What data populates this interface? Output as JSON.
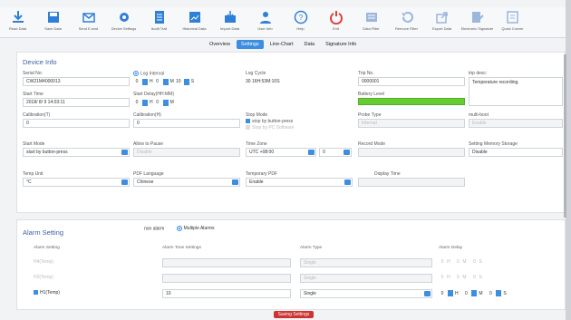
{
  "toolbar": [
    {
      "label": "Read Data",
      "icon": "download-icon",
      "color": "#2f7fd6"
    },
    {
      "label": "Save Data",
      "icon": "save-icon",
      "color": "#2f7fd6"
    },
    {
      "label": "Send E-mail",
      "icon": "mail-icon",
      "color": "#2f7fd6"
    },
    {
      "label": "Device Settings",
      "icon": "gear-icon",
      "color": "#2f7fd6"
    },
    {
      "label": "Audit Trail",
      "icon": "document-icon",
      "color": "#2f7fd6"
    },
    {
      "label": "Historical Data",
      "icon": "history-icon",
      "color": "#2f7fd6"
    },
    {
      "label": "Import Data",
      "icon": "import-icon",
      "color": "#2f7fd6"
    },
    {
      "label": "User Info",
      "icon": "user-icon",
      "color": "#2f7fd6"
    },
    {
      "label": "Help",
      "icon": "help-icon",
      "color": "#2f7fd6"
    },
    {
      "label": "Exit",
      "icon": "power-icon",
      "color": "#e04040"
    },
    {
      "label": "Data Filter",
      "icon": "filter-icon",
      "color": "#9cb6dc"
    },
    {
      "label": "Remove Filter",
      "icon": "undo-icon",
      "color": "#9cb6dc"
    },
    {
      "label": "Export Data",
      "icon": "export-icon",
      "color": "#9cb6dc"
    },
    {
      "label": "Electronic Signature",
      "icon": "signature-icon",
      "color": "#9cb6dc"
    },
    {
      "label": "Quick Conver",
      "icon": "convert-icon",
      "color": "#9cb6dc"
    }
  ],
  "tabs": [
    "Overview",
    "Settings",
    "Line-Chart",
    "Data",
    "Signature Info"
  ],
  "active_tab": 1,
  "device": {
    "title": "Device Info",
    "serial_no_label": "Serial No:",
    "serial_no": "CW21M4000013",
    "log_interval_label": "Log Interval",
    "log_interval": {
      "h": "0",
      "h_unit": "H",
      "m": "0",
      "m_unit": "M",
      "s": "10",
      "s_unit": "S"
    },
    "log_cycle_label": "Log Cycle",
    "log_cycle": "30 16H:53M:10S",
    "trip_no_label": "Trip No.",
    "trip_no": "0000001",
    "trip_desc_label": "trip desc:",
    "trip_desc": "Temperature recording.",
    "start_time_label": "Start Time",
    "start_time": "2018/ 8/ 9 14:03:11",
    "start_delay_label": "Start Delay(HH:MM)",
    "start_delay": {
      "h": "0",
      "h_unit": "H",
      "m": "0",
      "m_unit": "M"
    },
    "battery_label": "Battery Level",
    "calib_t_label": "Calibration(T)",
    "calib_t": "0",
    "calib_h_label": "Calibration(H)",
    "calib_h": "0",
    "stop_mode_label": "Stop Mode",
    "stop_opt1": "stop by button-press",
    "stop_opt2": "Stop by PC Software",
    "probe_type_label": "Probe Type",
    "probe_type": "Internal",
    "multi_boot_label": "multi-boot",
    "multi_boot": "Enable",
    "start_mode_label": "Start Mode",
    "start_mode": "start by button-press",
    "allow_pause_label": "Allow to Pause",
    "allow_pause": "Disable",
    "time_zone_label": "Time Zone",
    "time_zone": "UTC +08:00",
    "time_zone_min": "0",
    "record_mode_label": "Record Mode",
    "setting_memory_label": "Setting Memory Storage",
    "setting_memory": "Disable",
    "temp_unit_label": "Temp Unit",
    "temp_unit": "°C",
    "pdf_lang_label": "PDF Language",
    "pdf_lang": "Chinese",
    "temp_pdf_label": "Temporary PDF",
    "temp_pdf": "Enable",
    "display_time_label": "Display Time"
  },
  "alarm": {
    "title": "Alarm Setting",
    "mode_none": "non alarm",
    "mode_multi": "Multiple Alarms",
    "col_setting": "Alarm Setting",
    "col_tone": "Alarm Tone Settings",
    "col_type": "Alarm Type",
    "col_delay": "Alarm Delay",
    "rows": [
      {
        "label": "H4(Temp)",
        "checked": false,
        "tone": "",
        "type": "Single",
        "h": "0",
        "m": "0",
        "s": "0",
        "enabled": false
      },
      {
        "label": "H2(Temp)",
        "checked": false,
        "tone": "",
        "type": "Single",
        "h": "0",
        "m": "0",
        "s": "0",
        "enabled": false
      },
      {
        "label": "H1(Temp)",
        "checked": true,
        "tone": "10",
        "type": "Single",
        "h": "0",
        "m": "0",
        "s": "0",
        "enabled": true
      }
    ],
    "units": {
      "h": "H",
      "m": "M",
      "s": "S"
    }
  },
  "bottom_button": "Saving Settings"
}
